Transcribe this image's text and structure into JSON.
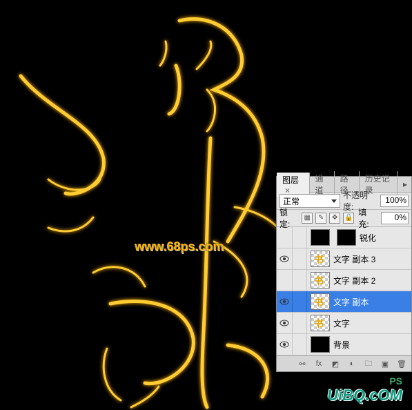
{
  "watermarks": {
    "center": "www.68ps.com",
    "br_text1": "PS",
    "br_text2": "UiBQ.cOM"
  },
  "panel": {
    "tabs": {
      "layers": "图层",
      "channels": "通道",
      "paths": "路径",
      "history": "历史记录"
    },
    "close_x": "×",
    "blend_mode": "正常",
    "opacity_label": "不透明度:",
    "opacity_value": "100%",
    "lock_label": "锁定:",
    "fill_label": "填充:",
    "fill_value": "0%",
    "layers": [
      {
        "name": "锐化",
        "visible": false,
        "type": "adjust"
      },
      {
        "name": "文字 副本 3",
        "visible": true,
        "type": "text"
      },
      {
        "name": "文字 副本 2",
        "visible": false,
        "type": "text"
      },
      {
        "name": "文字 副本",
        "visible": true,
        "type": "text",
        "selected": true
      },
      {
        "name": "文字",
        "visible": true,
        "type": "text"
      },
      {
        "name": "背景",
        "visible": true,
        "type": "bg"
      }
    ],
    "footer": {
      "link": "链接",
      "fx": "fx",
      "mask": "蒙版",
      "adjust": "调整",
      "group": "组",
      "new": "新建",
      "trash": "删除"
    }
  }
}
